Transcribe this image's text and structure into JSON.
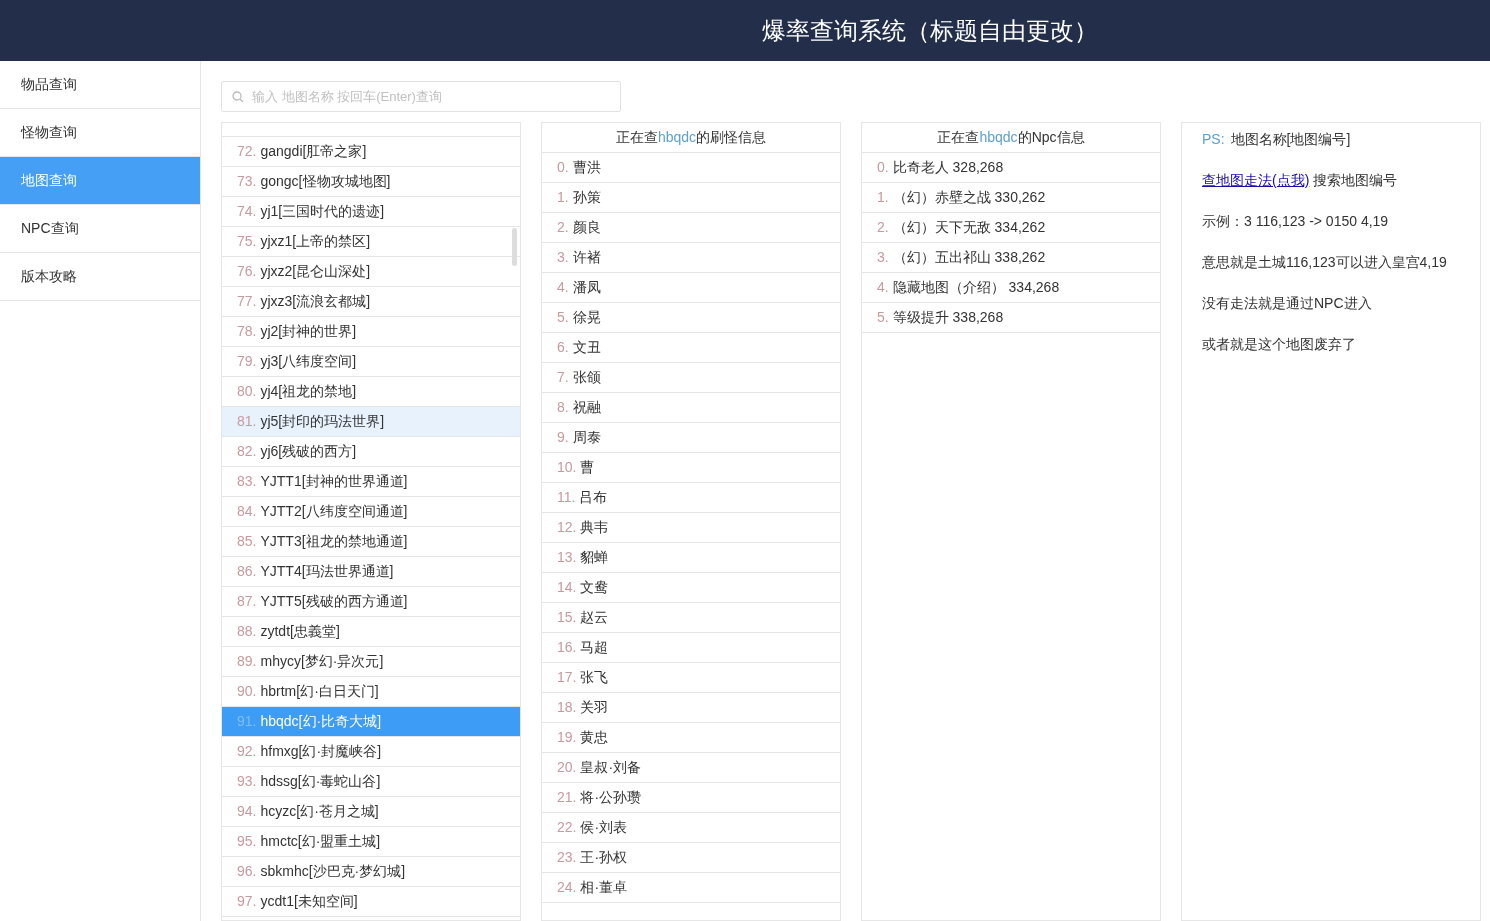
{
  "header": {
    "title": "爆率查询系统（标题自由更改）"
  },
  "sidebar": {
    "items": [
      {
        "label": "物品查询",
        "selected": false
      },
      {
        "label": "怪物查询",
        "selected": false
      },
      {
        "label": "地图查询",
        "selected": true
      },
      {
        "label": "NPC查询",
        "selected": false
      },
      {
        "label": "版本攻略",
        "selected": false
      }
    ]
  },
  "search": {
    "placeholder": "输入 地图名称 按回车(Enter)查询"
  },
  "maps": [
    {
      "index": "72.",
      "name": "gangdi[肛帝之家]",
      "selected": false,
      "hovered": false
    },
    {
      "index": "73.",
      "name": "gongc[怪物攻城地图]",
      "selected": false,
      "hovered": false
    },
    {
      "index": "74.",
      "name": "yj1[三国时代的遗迹]",
      "selected": false,
      "hovered": false
    },
    {
      "index": "75.",
      "name": "yjxz1[上帝的禁区]",
      "selected": false,
      "hovered": false
    },
    {
      "index": "76.",
      "name": "yjxz2[昆仑山深处]",
      "selected": false,
      "hovered": false
    },
    {
      "index": "77.",
      "name": "yjxz3[流浪玄都城]",
      "selected": false,
      "hovered": false
    },
    {
      "index": "78.",
      "name": "yj2[封神的世界]",
      "selected": false,
      "hovered": false
    },
    {
      "index": "79.",
      "name": "yj3[八纬度空间]",
      "selected": false,
      "hovered": false
    },
    {
      "index": "80.",
      "name": "yj4[祖龙的禁地]",
      "selected": false,
      "hovered": false
    },
    {
      "index": "81.",
      "name": "yj5[封印的玛法世界]",
      "selected": false,
      "hovered": true
    },
    {
      "index": "82.",
      "name": "yj6[残破的西方]",
      "selected": false,
      "hovered": false
    },
    {
      "index": "83.",
      "name": "YJTT1[封神的世界通道]",
      "selected": false,
      "hovered": false
    },
    {
      "index": "84.",
      "name": "YJTT2[八纬度空间通道]",
      "selected": false,
      "hovered": false
    },
    {
      "index": "85.",
      "name": "YJTT3[祖龙的禁地通道]",
      "selected": false,
      "hovered": false
    },
    {
      "index": "86.",
      "name": "YJTT4[玛法世界通道]",
      "selected": false,
      "hovered": false
    },
    {
      "index": "87.",
      "name": "YJTT5[残破的西方通道]",
      "selected": false,
      "hovered": false
    },
    {
      "index": "88.",
      "name": "zytdt[忠義堂]",
      "selected": false,
      "hovered": false
    },
    {
      "index": "89.",
      "name": "mhycy[梦幻·异次元]",
      "selected": false,
      "hovered": false
    },
    {
      "index": "90.",
      "name": "hbrtm[幻·白日天门]",
      "selected": false,
      "hovered": false
    },
    {
      "index": "91.",
      "name": "hbqdc[幻·比奇大城]",
      "selected": true,
      "hovered": false
    },
    {
      "index": "92.",
      "name": "hfmxg[幻·封魔峡谷]",
      "selected": false,
      "hovered": false
    },
    {
      "index": "93.",
      "name": "hdssg[幻·毒蛇山谷]",
      "selected": false,
      "hovered": false
    },
    {
      "index": "94.",
      "name": "hcyzc[幻·苍月之城]",
      "selected": false,
      "hovered": false
    },
    {
      "index": "95.",
      "name": "hmctc[幻·盟重土城]",
      "selected": false,
      "hovered": false
    },
    {
      "index": "96.",
      "name": "sbkmhc[沙巴克·梦幻城]",
      "selected": false,
      "hovered": false
    },
    {
      "index": "97.",
      "name": "ycdt1[未知空间]",
      "selected": false,
      "hovered": false
    }
  ],
  "monsters": {
    "title_before": "正在查",
    "map_code": "hbqdc",
    "title_after": "的刷怪信息",
    "items": [
      {
        "index": "0.",
        "name": "曹洪"
      },
      {
        "index": "1.",
        "name": "孙策"
      },
      {
        "index": "2.",
        "name": "颜良"
      },
      {
        "index": "3.",
        "name": "许褚"
      },
      {
        "index": "4.",
        "name": "潘凤"
      },
      {
        "index": "5.",
        "name": "徐晃"
      },
      {
        "index": "6.",
        "name": "文丑"
      },
      {
        "index": "7.",
        "name": "张颌"
      },
      {
        "index": "8.",
        "name": "祝融"
      },
      {
        "index": "9.",
        "name": "周泰"
      },
      {
        "index": "10.",
        "name": "曹"
      },
      {
        "index": "11.",
        "name": "吕布"
      },
      {
        "index": "12.",
        "name": "典韦"
      },
      {
        "index": "13.",
        "name": "貂蝉"
      },
      {
        "index": "14.",
        "name": "文鸯"
      },
      {
        "index": "15.",
        "name": "赵云"
      },
      {
        "index": "16.",
        "name": "马超"
      },
      {
        "index": "17.",
        "name": "张飞"
      },
      {
        "index": "18.",
        "name": "关羽"
      },
      {
        "index": "19.",
        "name": "黄忠"
      },
      {
        "index": "20.",
        "name": "皇叔·刘备"
      },
      {
        "index": "21.",
        "name": "将·公孙瓒"
      },
      {
        "index": "22.",
        "name": "侯·刘表"
      },
      {
        "index": "23.",
        "name": "王·孙权"
      },
      {
        "index": "24.",
        "name": "相·董卓"
      }
    ]
  },
  "npcs": {
    "title_before": "正在查",
    "map_code": "hbqdc",
    "title_after": "的Npc信息",
    "items": [
      {
        "index": "0.",
        "name": "比奇老人 328,268"
      },
      {
        "index": "1.",
        "name": "（幻）赤壁之战 330,262"
      },
      {
        "index": "2.",
        "name": "（幻）天下无敌 334,262"
      },
      {
        "index": "3.",
        "name": "（幻）五出祁山 338,262"
      },
      {
        "index": "4.",
        "name": "隐藏地图（介绍） 334,268"
      },
      {
        "index": "5.",
        "name": "等级提升 338,268"
      }
    ]
  },
  "notes": {
    "ps_label": "PS:",
    "ps_text": "地图名称[地图编号]",
    "link": "查地图走法(点我)",
    "link_after": "搜索地图编号",
    "lines": [
      "示例：3 116,123 -> 0150 4,19",
      "意思就是土城116,123可以进入皇宫4,19",
      "没有走法就是通过NPC进入",
      "或者就是这个地图废弃了"
    ]
  }
}
